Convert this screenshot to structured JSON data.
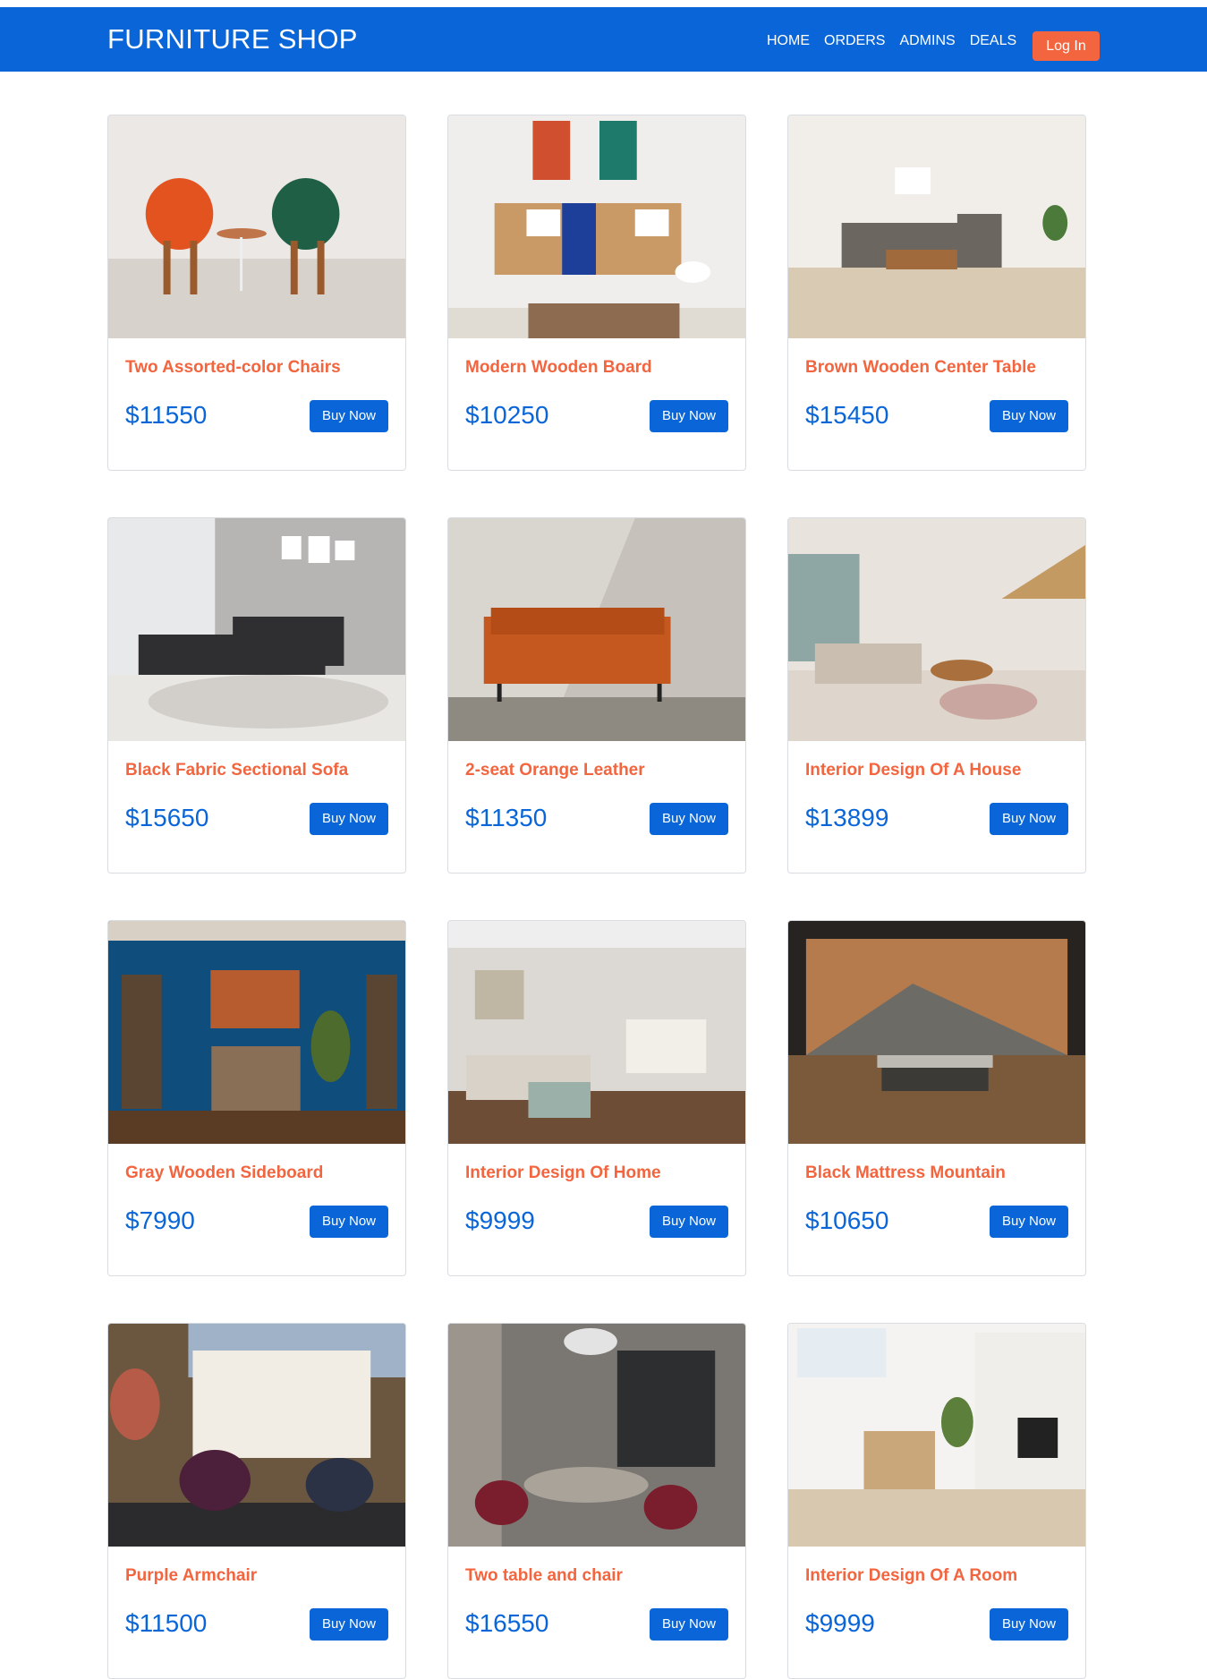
{
  "header": {
    "brand": "FURNITURE SHOP",
    "nav": [
      "HOME",
      "ORDERS",
      "ADMINS",
      "DEALS"
    ],
    "login_label": "Log In"
  },
  "colors": {
    "primary": "#0a66d8",
    "accent": "#f2653f"
  },
  "products": [
    {
      "title": "Two Assorted-color Chairs",
      "price": "$11550",
      "button": "Buy Now",
      "image": "assorted-chairs-photo"
    },
    {
      "title": "Modern Wooden Board",
      "price": "$10250",
      "button": "Buy Now",
      "image": "wooden-board-photo"
    },
    {
      "title": "Brown Wooden Center Table",
      "price": "$15450",
      "button": "Buy Now",
      "image": "living-room-photo"
    },
    {
      "title": "Black Fabric Sectional Sofa",
      "price": "$15650",
      "button": "Buy Now",
      "image": "sectional-sofa-photo"
    },
    {
      "title": "2-seat Orange Leather",
      "price": "$11350",
      "button": "Buy Now",
      "image": "orange-sofa-photo"
    },
    {
      "title": "Interior Design Of A House",
      "price": "$13899",
      "button": "Buy Now",
      "image": "house-interior-photo"
    },
    {
      "title": "Gray Wooden Sideboard",
      "price": "$7990",
      "button": "Buy Now",
      "image": "sideboard-photo"
    },
    {
      "title": "Interior Design Of Home",
      "price": "$9999",
      "button": "Buy Now",
      "image": "home-interior-photo"
    },
    {
      "title": "Black Mattress Mountain",
      "price": "$10650",
      "button": "Buy Now",
      "image": "mattress-mountain-photo"
    },
    {
      "title": "Purple Armchair",
      "price": "$11500",
      "button": "Buy Now",
      "image": "purple-armchair-photo"
    },
    {
      "title": "Two table and chair",
      "price": "$16550",
      "button": "Buy Now",
      "image": "dining-table-photo"
    },
    {
      "title": "Interior Design Of A Room",
      "price": "$9999",
      "button": "Buy Now",
      "image": "room-interior-photo"
    }
  ]
}
